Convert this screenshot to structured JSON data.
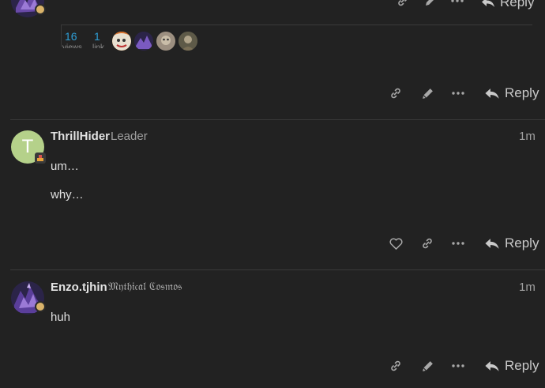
{
  "posts": [
    {
      "map": {
        "views_count": "16",
        "views_label": "views",
        "links_count": "1",
        "links_label": "link"
      },
      "actions": {
        "reply_label": "Reply"
      }
    },
    {
      "avatar_letter": "T",
      "username": "ThrillHider",
      "user_title": "Leader",
      "time": "1m",
      "paragraphs": [
        "um…",
        "why…"
      ],
      "actions": {
        "reply_label": "Reply"
      }
    },
    {
      "username": "Enzo.tjhin",
      "user_title": "𝔐𝔶𝔱𝔥𝔦𝔠𝔞𝔩 ℭ𝔬𝔰𝔪𝔬𝔰",
      "time": "1m",
      "paragraphs": [
        "huh"
      ],
      "actions": {
        "reply_label": "Reply"
      }
    }
  ],
  "colors": {
    "background": "#222222",
    "link_blue": "#2e9ed6",
    "avatar_green": "#b5d18a"
  },
  "icons": [
    "link-icon",
    "pencil-icon",
    "ellipsis-icon",
    "reply-arrow-icon",
    "heart-icon"
  ]
}
